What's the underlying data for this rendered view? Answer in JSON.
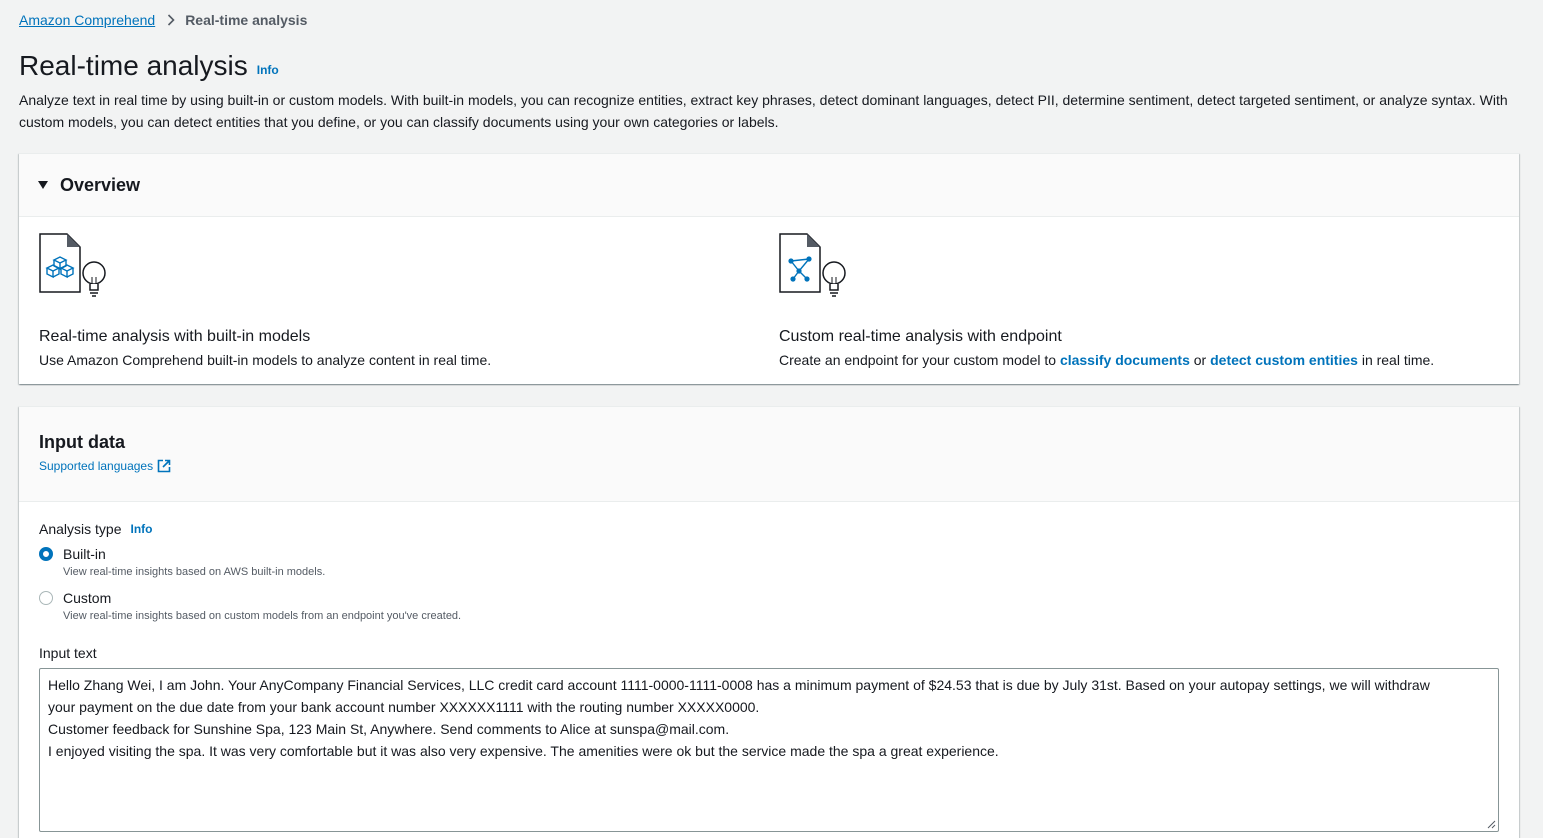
{
  "breadcrumb": {
    "parent": "Amazon Comprehend",
    "current": "Real-time analysis"
  },
  "header": {
    "title": "Real-time analysis",
    "info": "Info",
    "description": "Analyze text in real time by using built-in or custom models. With built-in models, you can recognize entities, extract key phrases, detect dominant languages, detect PII, determine sentiment, detect targeted sentiment, or analyze syntax. With custom models, you can detect entities that you define, or you can classify documents using your own categories or labels."
  },
  "overview": {
    "title": "Overview",
    "builtin": {
      "heading": "Real-time analysis with built-in models",
      "text": "Use Amazon Comprehend built-in models to analyze content in real time."
    },
    "custom": {
      "heading": "Custom real-time analysis with endpoint",
      "text_before": "Create an endpoint for your custom model to ",
      "link1": "classify documents",
      "text_middle": " or ",
      "link2": "detect custom entities",
      "text_after": " in real time."
    }
  },
  "input_data": {
    "title": "Input data",
    "supported_languages": "Supported languages",
    "analysis_type": {
      "label": "Analysis type",
      "info": "Info",
      "options": [
        {
          "label": "Built-in",
          "description": "View real-time insights based on AWS built-in models.",
          "selected": true
        },
        {
          "label": "Custom",
          "description": "View real-time insights based on custom models from an endpoint you've created.",
          "selected": false
        }
      ]
    },
    "input_text": {
      "label": "Input text",
      "lines": [
        "Hello Zhang Wei, I am John. Your AnyCompany Financial Services, LLC credit card account 1111-0000-1111-0008 has a minimum payment of $24.53 that is due by July 31st. Based on your autopay settings, we will withdraw",
        "your payment on the due date from your bank account number XXXXXX1111 with the routing number XXXXX0000.",
        "Customer feedback for Sunshine Spa, 123 Main St, Anywhere. Send comments to Alice at sunspa@mail.com.",
        "I enjoyed visiting the spa. It was very comfortable but it was also very expensive. The amenities were ok but the service made the spa a great experience."
      ]
    }
  },
  "colors": {
    "link": "#0073bb",
    "background": "#f2f3f3",
    "text": "#16191f"
  }
}
